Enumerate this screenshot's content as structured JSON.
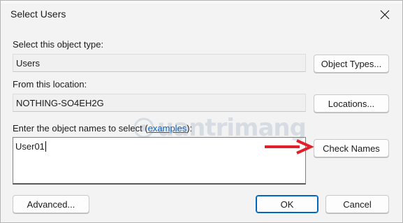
{
  "window": {
    "title": "Select Users"
  },
  "object_type": {
    "label": "Select this object type:",
    "value": "Users",
    "button": "Object Types..."
  },
  "location": {
    "label": "From this location:",
    "value": "NOTHING-SO4EH2G",
    "button": "Locations..."
  },
  "names": {
    "label_prefix": "Enter the object names to select (",
    "link": "examples",
    "label_suffix": "):",
    "value": "User01",
    "check_button": "Check Names"
  },
  "footer": {
    "advanced": "Advanced...",
    "ok": "OK",
    "cancel": "Cancel"
  },
  "watermark": {
    "text": "uantrimang"
  },
  "colors": {
    "accent": "#0067c0",
    "arrow": "#e0202a",
    "link": "#0a5fc4"
  }
}
